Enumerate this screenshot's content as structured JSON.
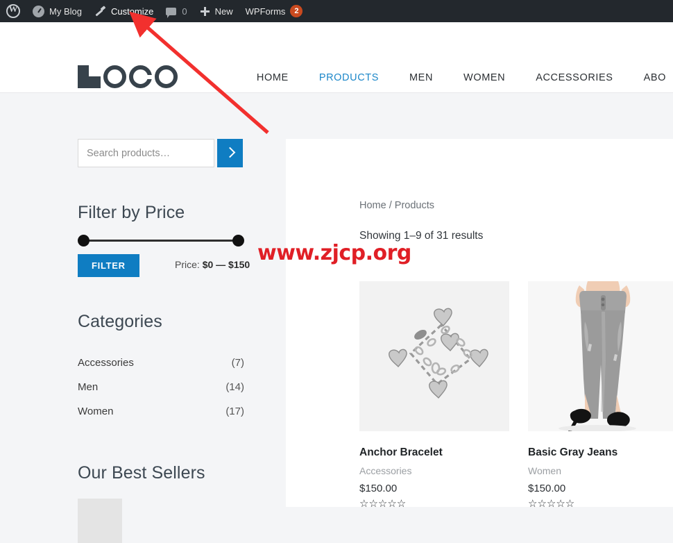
{
  "adminbar": {
    "wp_logo_icon": "wordpress-icon",
    "items": [
      {
        "icon": "gauge-icon",
        "label": "My Blog"
      },
      {
        "icon": "brush-icon",
        "label": "Customize"
      },
      {
        "icon": "comment-icon",
        "label": "0"
      },
      {
        "icon": "plus-icon",
        "label": "New"
      },
      {
        "icon": "",
        "label": "WPForms",
        "badge": "2"
      }
    ],
    "badge_color": "#ca4a1f"
  },
  "header": {
    "logo_text": "LOGO",
    "nav": [
      {
        "label": "HOME",
        "active": false
      },
      {
        "label": "PRODUCTS",
        "active": true
      },
      {
        "label": "MEN",
        "active": false
      },
      {
        "label": "WOMEN",
        "active": false
      },
      {
        "label": "ACCESSORIES",
        "active": false
      },
      {
        "label": "ABO",
        "active": false
      }
    ],
    "accent_color": "#1c87c9"
  },
  "sidebar": {
    "search": {
      "placeholder": "Search products…",
      "value": "",
      "button_icon": "chevron-right-icon"
    },
    "price_filter": {
      "title": "Filter by Price",
      "button_label": "FILTER",
      "price_prefix": "Price:",
      "price_range": "$0 — $150",
      "min": 0,
      "max": 150
    },
    "categories": {
      "title": "Categories",
      "items": [
        {
          "label": "Accessories",
          "count": "(7)"
        },
        {
          "label": "Men",
          "count": "(14)"
        },
        {
          "label": "Women",
          "count": "(17)"
        }
      ]
    },
    "best_sellers": {
      "title": "Our Best Sellers"
    }
  },
  "main": {
    "breadcrumb_home": "Home",
    "breadcrumb_sep": "/",
    "breadcrumb_current": "Products",
    "results_text": "Showing 1–9 of 31 results",
    "products": [
      {
        "title": "Anchor Bracelet",
        "category": "Accessories",
        "price": "$150.00",
        "stars": "☆☆☆☆☆",
        "image": "silver-heart-charm-bracelet"
      },
      {
        "title": "Basic Gray Jeans",
        "category": "Women",
        "price": "$150.00",
        "stars": "☆☆☆☆☆",
        "image": "model-wearing-gray-skinny-jeans"
      }
    ]
  },
  "annotations": {
    "watermark": "www.zjcp.org",
    "watermark_color": "#e01f26",
    "arrow_color": "#f2302e",
    "arrow_target": "Customize"
  }
}
